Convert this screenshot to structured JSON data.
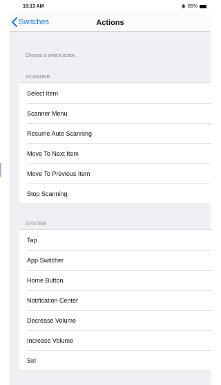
{
  "status_bar": {
    "time": "10:13 AM",
    "battery": "85%"
  },
  "nav": {
    "back_label": "Switches",
    "title": "Actions"
  },
  "hint": "Choose a switch action.",
  "sections": [
    {
      "header": "SCANNER",
      "items": [
        "Select Item",
        "Scanner Menu",
        "Resume Auto Scanning",
        "Move To Next Item",
        "Move To Previous Item",
        "Stop Scanning"
      ]
    },
    {
      "header": "SYSTEM",
      "items": [
        "Tap",
        "App Switcher",
        "Home Button",
        "Notification Center",
        "Decrease Volume",
        "Increase Volume",
        "Siri"
      ]
    }
  ],
  "colors": {
    "accent": "#1577f6",
    "background": "#efeff4",
    "header_text": "#7c7c82"
  }
}
